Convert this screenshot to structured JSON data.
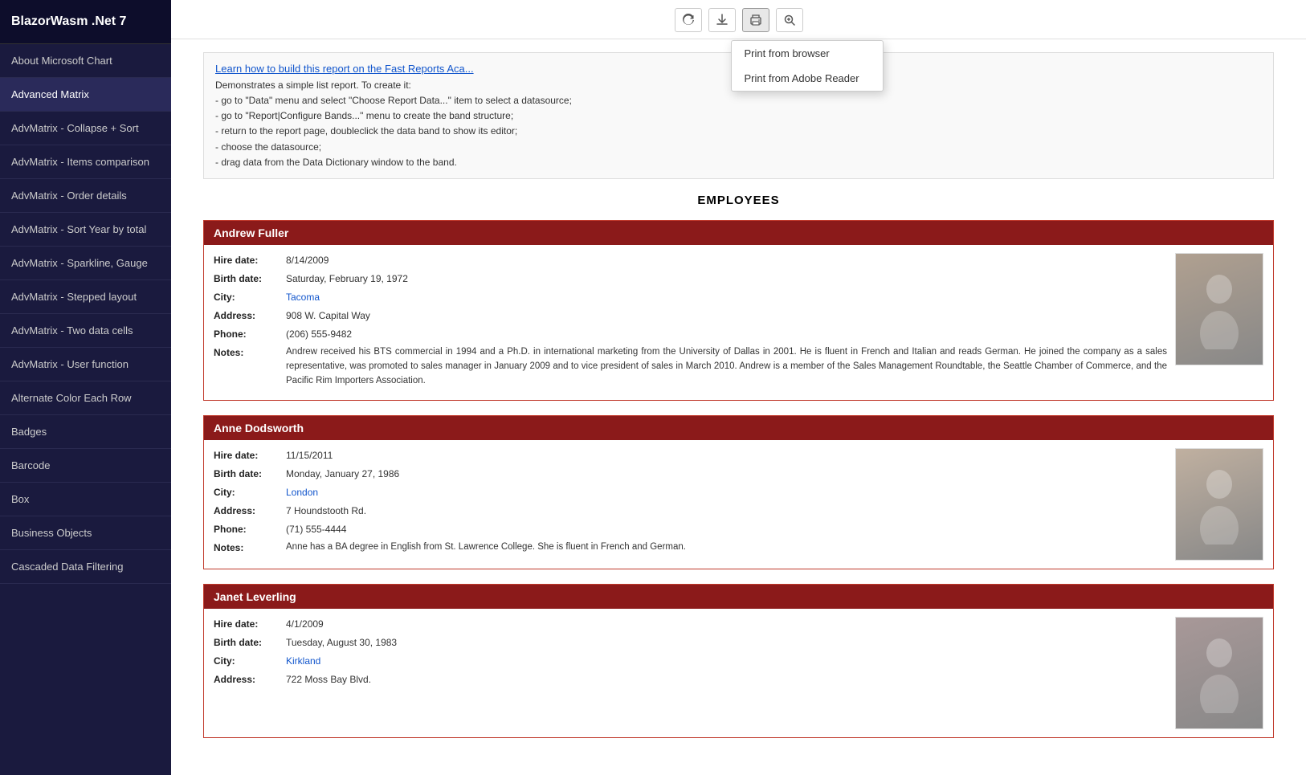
{
  "app": {
    "title": "BlazorWasm .Net 7"
  },
  "sidebar": {
    "items": [
      {
        "id": "about-microsoft-chart",
        "label": "About Microsoft Chart"
      },
      {
        "id": "advanced-matrix",
        "label": "Advanced Matrix",
        "active": true
      },
      {
        "id": "advmatrix-collapse-sort",
        "label": "AdvMatrix - Collapse + Sort"
      },
      {
        "id": "advmatrix-items-comparison",
        "label": "AdvMatrix - Items comparison"
      },
      {
        "id": "advmatrix-order-details",
        "label": "AdvMatrix - Order details"
      },
      {
        "id": "advmatrix-sort-year-by-total",
        "label": "AdvMatrix - Sort Year by total"
      },
      {
        "id": "advmatrix-sparkline-gauge",
        "label": "AdvMatrix - Sparkline, Gauge"
      },
      {
        "id": "advmatrix-stepped-layout",
        "label": "AdvMatrix - Stepped layout"
      },
      {
        "id": "advmatrix-two-data-cells",
        "label": "AdvMatrix - Two data cells"
      },
      {
        "id": "advmatrix-user-function",
        "label": "AdvMatrix - User function"
      },
      {
        "id": "alternate-color-each-row",
        "label": "Alternate Color Each Row"
      },
      {
        "id": "badges",
        "label": "Badges"
      },
      {
        "id": "barcode",
        "label": "Barcode"
      },
      {
        "id": "box",
        "label": "Box"
      },
      {
        "id": "business-objects",
        "label": "Business Objects"
      },
      {
        "id": "cascaded-data-filtering",
        "label": "Cascaded Data Filtering"
      }
    ]
  },
  "toolbar": {
    "refresh_title": "Refresh",
    "download_title": "Download",
    "print_title": "Print",
    "zoom_title": "Zoom"
  },
  "print_dropdown": {
    "visible": true,
    "items": [
      {
        "id": "print-browser",
        "label": "Print from browser"
      },
      {
        "id": "print-adobe",
        "label": "Print from Adobe Reader"
      }
    ]
  },
  "report": {
    "link_text": "Learn how to build this report on the Fast Reports Aca...",
    "link_href": "#",
    "description_lines": [
      "Demonstrates a simple list report. To create it:",
      "- go to \"Data\" menu and select \"Choose Report Data...\" item to select a datasource;",
      "- go to \"Report|Configure Bands...\" menu to create the band structure;",
      "- return to the report page, doubleclick the data band to show its editor;",
      "- choose the datasource;",
      "- drag data from the Data Dictionary window to the band."
    ],
    "title": "EMPLOYEES",
    "employees": [
      {
        "name": "Andrew Fuller",
        "hire_date": "8/14/2009",
        "birth_date": "Saturday, February 19, 1972",
        "city": "Tacoma",
        "address": "908 W. Capital Way",
        "phone": "(206) 555-9482",
        "notes": "Andrew received his BTS commercial in 1994 and a Ph.D. in international marketing from the University of Dallas in 2001.  He is fluent in French and Italian and reads German.  He joined the company as a sales representative, was promoted to sales manager in January 2009 and to vice president of sales in March 2010.  Andrew is a member of the Sales Management Roundtable, the Seattle Chamber of Commerce, and the Pacific Rim Importers Association.",
        "photo_color": "#b0a090"
      },
      {
        "name": "Anne Dodsworth",
        "hire_date": "11/15/2011",
        "birth_date": "Monday, January 27, 1986",
        "city": "London",
        "address": "7 Houndstooth Rd.",
        "phone": "(71) 555-4444",
        "notes": "Anne has a BA degree in English from St. Lawrence College.  She is fluent in French and German.",
        "photo_color": "#c0b0a0"
      },
      {
        "name": "Janet Leverling",
        "hire_date": "4/1/2009",
        "birth_date": "Tuesday, August 30, 1983",
        "city": "Kirkland",
        "address": "722 Moss Bay Blvd.",
        "phone": "",
        "notes": "",
        "photo_color": "#a89898"
      }
    ],
    "labels": {
      "hire_date": "Hire date:",
      "birth_date": "Birth date:",
      "city": "City:",
      "address": "Address:",
      "phone": "Phone:",
      "notes": "Notes:"
    }
  }
}
